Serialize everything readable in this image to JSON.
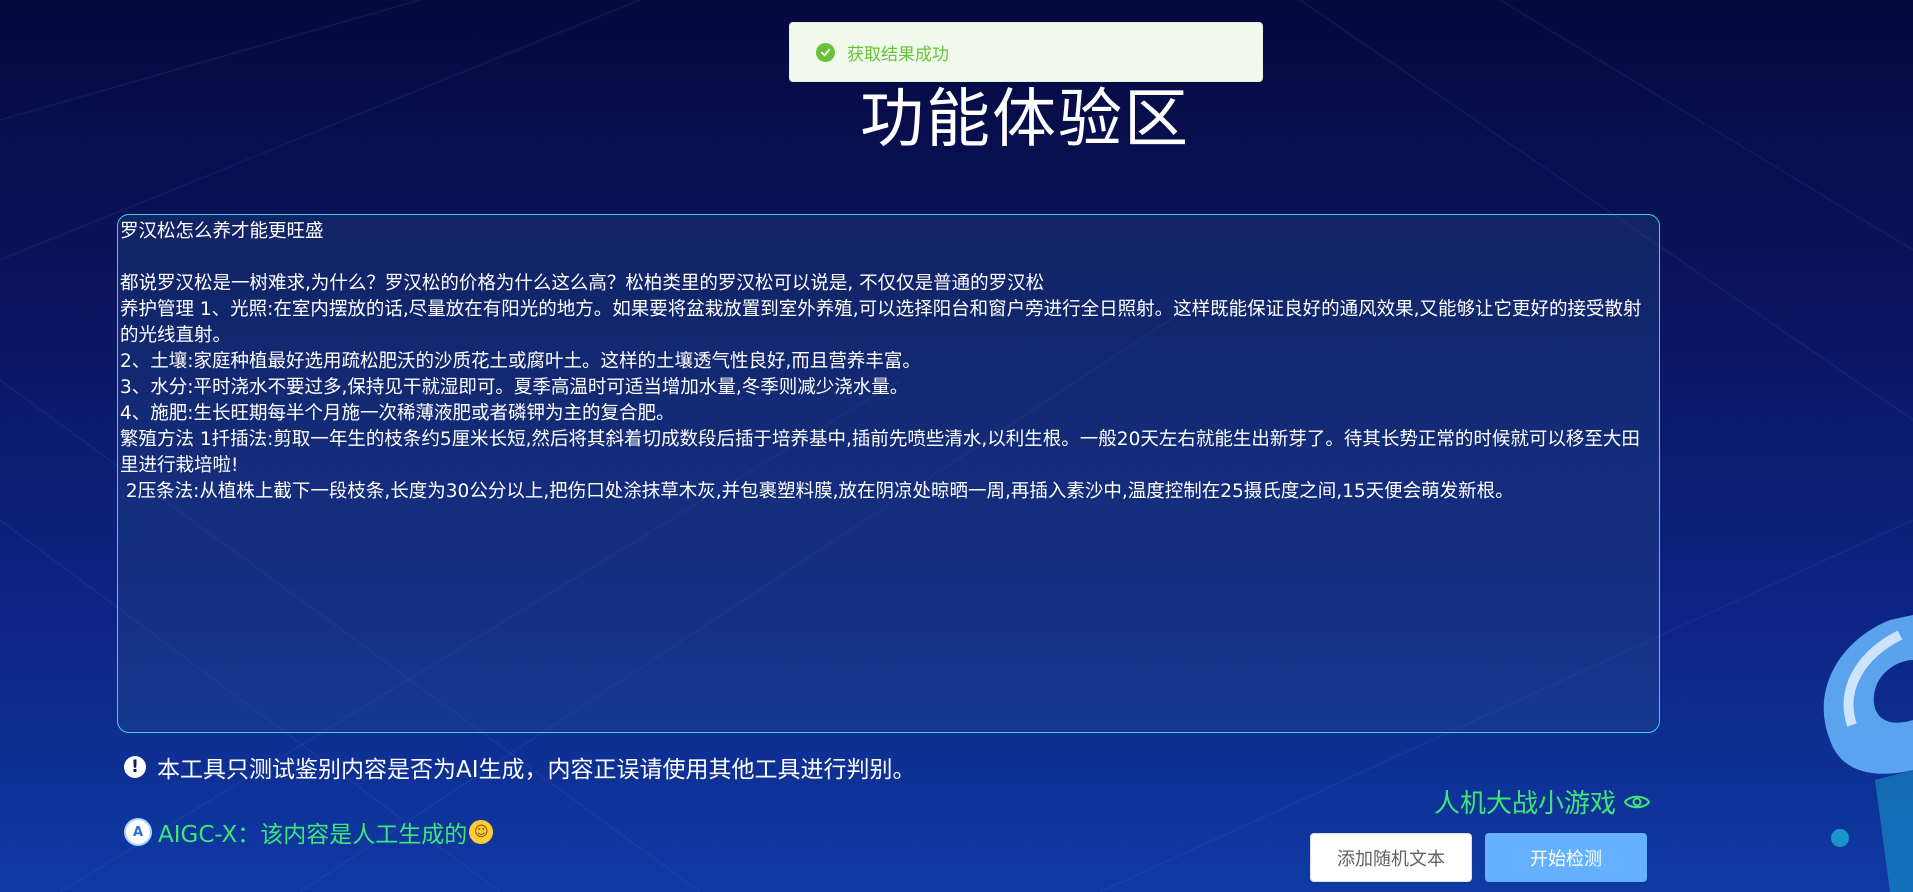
{
  "toast": {
    "icon": "check-circle-icon",
    "message": "获取结果成功",
    "color": "#67c23a"
  },
  "page": {
    "title": "功能体验区"
  },
  "editor": {
    "content": "罗汉松怎么养才能更旺盛\n\n都说罗汉松是一树难求,为什么？罗汉松的价格为什么这么高？松柏类里的罗汉松可以说是, 不仅仅是普通的罗汉松\n养护管理 1、光照:在室内摆放的话,尽量放在有阳光的地方。如果要将盆栽放置到室外养殖,可以选择阳台和窗户旁进行全日照射。这样既能保证良好的通风效果,又能够让它更好的接受散射的光线直射。\n2、土壤:家庭种植最好选用疏松肥沃的沙质花土或腐叶土。这样的土壤透气性良好,而且营养丰富。\n3、水分:平时浇水不要过多,保持见干就湿即可。夏季高温时可适当增加水量,冬季则减少浇水量。\n4、施肥:生长旺期每半个月施一次稀薄液肥或者磷钾为主的复合肥。\n繁殖方法 1扦插法:剪取一年生的枝条约5厘米长短,然后将其斜着切成数段后插于培养基中,插前先喷些清水,以利生根。一般20天左右就能生出新芽了。待其长势正常的时候就可以移至大田里进行栽培啦!\n 2压条法:从植株上截下一段枝条,长度为30公分以上,把伤口处涂抹草木灰,并包裹塑料膜,放在阴凉处晾晒一周,再插入素沙中,温度控制在25摄氏度之间,15天便会萌发新根。"
  },
  "notice": {
    "icon": "exclamation-circle-icon",
    "text": "本工具只测试鉴别内容是否为AI生成，内容正误请使用其他工具进行判别。"
  },
  "result": {
    "logo_icon": "aigc-logo-icon",
    "logo_glyph": "A",
    "text": "AIGC-X：该内容是人工生成的",
    "emoji_icon": "smiling-face-icon",
    "color": "#3ee67a"
  },
  "game_link": {
    "label": "人机大战小游戏",
    "icon": "eye-icon"
  },
  "buttons": {
    "random_label": "添加随机文本",
    "start_label": "开始检测"
  }
}
